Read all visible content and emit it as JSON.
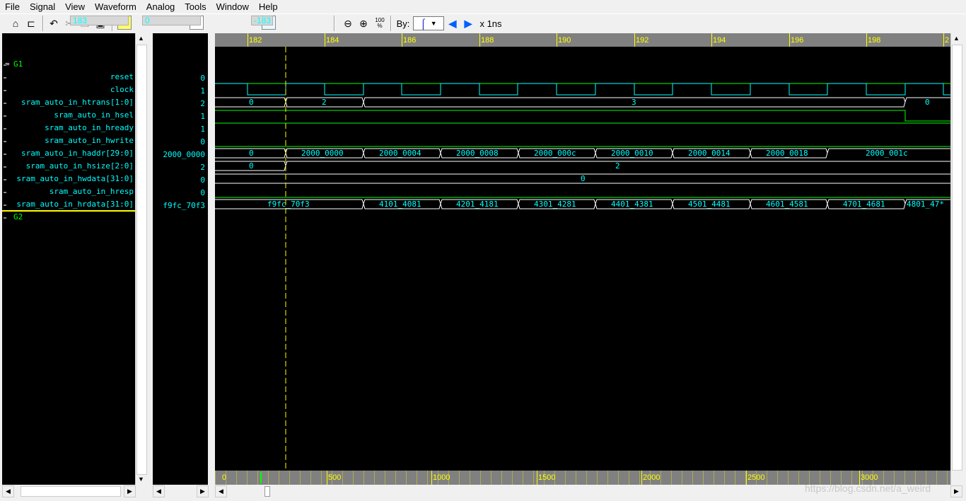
{
  "menu": [
    "File",
    "Signal",
    "View",
    "Waveform",
    "Analog",
    "Tools",
    "Window",
    "Help"
  ],
  "toolbar": {
    "cursor1": "183",
    "cursor2": "0",
    "delta": "-183",
    "by_label": "By:",
    "units": "x 1ns",
    "zoom_label": "100"
  },
  "groups": {
    "g1": "G1",
    "g2": "G2"
  },
  "signals": [
    {
      "name": "reset",
      "value": "0"
    },
    {
      "name": "clock",
      "value": "1"
    },
    {
      "name": "sram_auto_in_htrans[1:0]",
      "value": "2"
    },
    {
      "name": "sram_auto_in_hsel",
      "value": "1"
    },
    {
      "name": "sram_auto_in_hready",
      "value": "1"
    },
    {
      "name": "sram_auto_in_hwrite",
      "value": "0"
    },
    {
      "name": "sram_auto_in_haddr[29:0]",
      "value": "2000_0000"
    },
    {
      "name": "sram_auto_in_hsize[2:0]",
      "value": "2"
    },
    {
      "name": "sram_auto_in_hwdata[31:0]",
      "value": "0"
    },
    {
      "name": "sram_auto_in_hresp",
      "value": "0"
    },
    {
      "name": "sram_auto_in_hrdata[31:0]",
      "value": "f9fc_70f3"
    }
  ],
  "ruler": [
    "182",
    "184",
    "186",
    "188",
    "190",
    "192",
    "194",
    "196",
    "198",
    "2"
  ],
  "bus_values": {
    "htrans": [
      "0",
      "2",
      "3",
      "0"
    ],
    "haddr": [
      "0",
      "2000_0000",
      "2000_0004",
      "2000_0008",
      "2000_000c",
      "2000_0010",
      "2000_0014",
      "2000_0018",
      "2000_001c"
    ],
    "hsize": [
      "0",
      "2"
    ],
    "hwdata": [
      "0"
    ],
    "hrdata": [
      "f9fc_70f3",
      "4101_4081",
      "4201_4181",
      "4301_4281",
      "4401_4381",
      "4501_4481",
      "4601_4581",
      "4701_4681",
      "4801_47*"
    ]
  },
  "bottom_ruler": [
    "0",
    "500",
    "1000",
    "1500",
    "2000",
    "2500",
    "3000"
  ],
  "watermark": "https://blog.csdn.net/a_weird",
  "colors": {
    "bus": "#ffffff",
    "clock": "#00ffff",
    "signal": "#00ff00",
    "cursor": "#ffff00",
    "text": "#00ffff"
  }
}
